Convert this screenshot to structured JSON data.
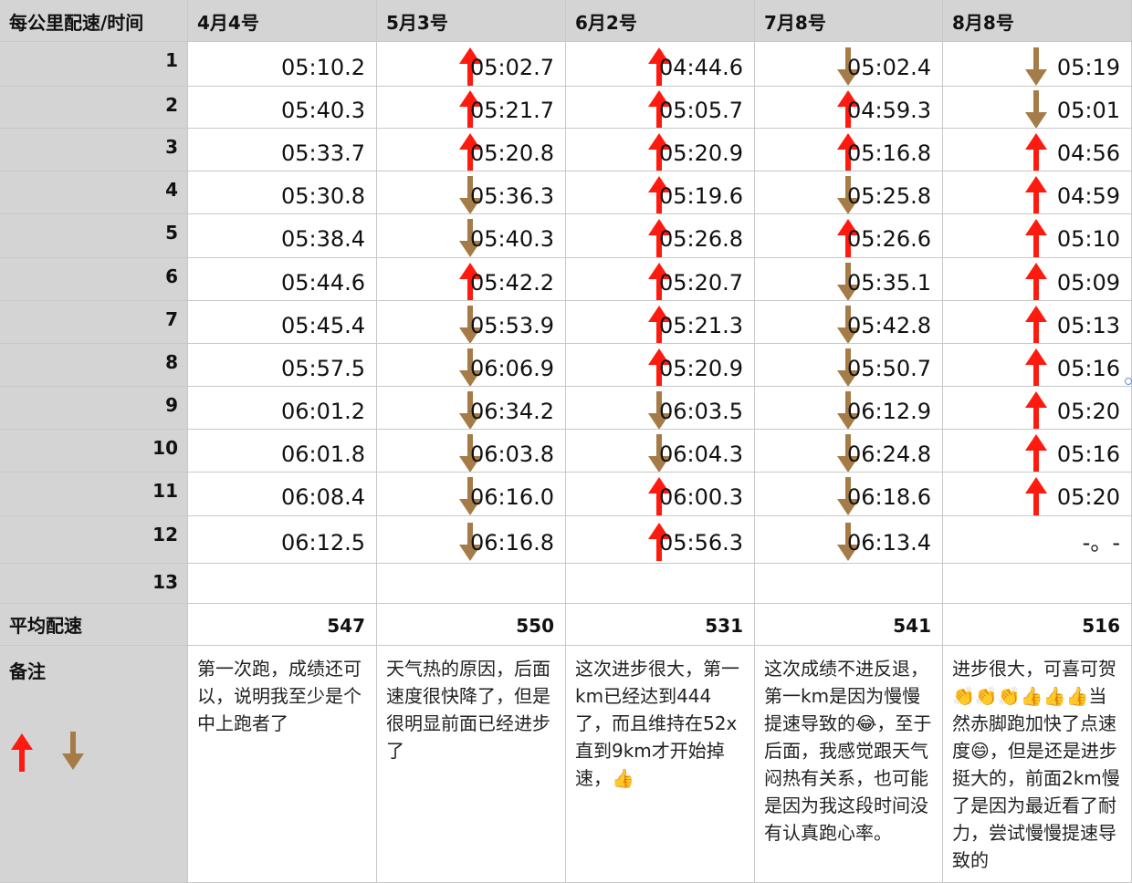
{
  "headers": [
    "每公里配速/时间",
    "4月4号",
    "5月3号",
    "6月2号",
    "7月8号",
    "8月8号"
  ],
  "row_labels": [
    "1",
    "2",
    "3",
    "4",
    "5",
    "6",
    "7",
    "8",
    "9",
    "10",
    "11",
    "12",
    "13"
  ],
  "rows": [
    [
      {
        "v": "05:10.2"
      },
      {
        "v": "05:02.7",
        "d": "up"
      },
      {
        "v": "04:44.6",
        "d": "up"
      },
      {
        "v": "05:02.4",
        "d": "down"
      },
      {
        "v": "05:19",
        "d": "down"
      }
    ],
    [
      {
        "v": "05:40.3"
      },
      {
        "v": "05:21.7",
        "d": "up"
      },
      {
        "v": "05:05.7",
        "d": "up"
      },
      {
        "v": "04:59.3",
        "d": "up"
      },
      {
        "v": "05:01",
        "d": "down"
      }
    ],
    [
      {
        "v": "05:33.7"
      },
      {
        "v": "05:20.8",
        "d": "up"
      },
      {
        "v": "05:20.9",
        "d": "up"
      },
      {
        "v": "05:16.8",
        "d": "up"
      },
      {
        "v": "04:56",
        "d": "up"
      }
    ],
    [
      {
        "v": "05:30.8"
      },
      {
        "v": "05:36.3",
        "d": "down"
      },
      {
        "v": "05:19.6",
        "d": "up"
      },
      {
        "v": "05:25.8",
        "d": "down"
      },
      {
        "v": "04:59",
        "d": "up"
      }
    ],
    [
      {
        "v": "05:38.4"
      },
      {
        "v": "05:40.3",
        "d": "down"
      },
      {
        "v": "05:26.8",
        "d": "up"
      },
      {
        "v": "05:26.6",
        "d": "up"
      },
      {
        "v": "05:10",
        "d": "up"
      }
    ],
    [
      {
        "v": "05:44.6"
      },
      {
        "v": "05:42.2",
        "d": "up"
      },
      {
        "v": "05:20.7",
        "d": "up"
      },
      {
        "v": "05:35.1",
        "d": "down"
      },
      {
        "v": "05:09",
        "d": "up"
      }
    ],
    [
      {
        "v": "05:45.4"
      },
      {
        "v": "05:53.9",
        "d": "down"
      },
      {
        "v": "05:21.3",
        "d": "up"
      },
      {
        "v": "05:42.8",
        "d": "down"
      },
      {
        "v": "05:13",
        "d": "up"
      }
    ],
    [
      {
        "v": "05:57.5"
      },
      {
        "v": "06:06.9",
        "d": "down"
      },
      {
        "v": "05:20.9",
        "d": "up"
      },
      {
        "v": "05:50.7",
        "d": "down"
      },
      {
        "v": "05:16",
        "d": "up"
      }
    ],
    [
      {
        "v": "06:01.2"
      },
      {
        "v": "06:34.2",
        "d": "down"
      },
      {
        "v": "06:03.5",
        "d": "down"
      },
      {
        "v": "06:12.9",
        "d": "down"
      },
      {
        "v": "05:20",
        "d": "up"
      }
    ],
    [
      {
        "v": "06:01.8"
      },
      {
        "v": "06:03.8",
        "d": "down"
      },
      {
        "v": "06:04.3",
        "d": "down"
      },
      {
        "v": "06:24.8",
        "d": "down"
      },
      {
        "v": "05:16",
        "d": "up"
      }
    ],
    [
      {
        "v": "06:08.4"
      },
      {
        "v": "06:16.0",
        "d": "down"
      },
      {
        "v": "06:00.3",
        "d": "up"
      },
      {
        "v": "06:18.6",
        "d": "down"
      },
      {
        "v": "05:20",
        "d": "up"
      }
    ],
    [
      {
        "v": "06:12.5"
      },
      {
        "v": "06:16.8",
        "d": "down"
      },
      {
        "v": "05:56.3",
        "d": "up"
      },
      {
        "v": "06:13.4",
        "d": "down"
      },
      {
        "v": "-。-"
      }
    ],
    [
      {
        "v": ""
      },
      {
        "v": ""
      },
      {
        "v": ""
      },
      {
        "v": ""
      },
      {
        "v": ""
      }
    ]
  ],
  "avg_label": "平均配速",
  "averages": [
    "547",
    "550",
    "531",
    "541",
    "516"
  ],
  "notes_label": "备注",
  "notes": [
    "第一次跑，成绩还可以，说明我至少是个中上跑者了",
    "天气热的原因，后面速度很快降了，但是很明显前面已经进步了",
    "这次进步很大，第一km已经达到444了，而且维持在52x直到9km才开始掉速，👍",
    "这次成绩不进反退，第一km是因为慢慢提速导致的😂，至于后面，我感觉跟天气闷热有关系，也可能是因为我这段时间没有认真跑心率。",
    "进步很大，可喜可贺👏👏👏👍👍👍当然赤脚跑加快了点速度😄，但是还是进步挺大的，前面2km慢了是因为最近看了耐力，尝试慢慢提速导致的"
  ],
  "colors": {
    "up": "#ff1a10",
    "down": "#a57c47",
    "header_bg": "#d4d4d4",
    "grid": "#c8c8c8"
  }
}
